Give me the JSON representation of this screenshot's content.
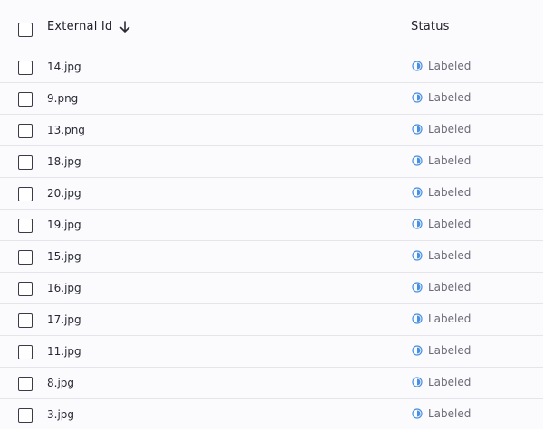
{
  "columns": {
    "external_id": "External Id",
    "status": "Status"
  },
  "sort_icon": "arrow-down-icon",
  "status_icon": "half-circle-icon",
  "status_color": "#4a90e2",
  "rows": [
    {
      "file": "14.jpg",
      "status": "Labeled"
    },
    {
      "file": "9.png",
      "status": "Labeled"
    },
    {
      "file": "13.png",
      "status": "Labeled"
    },
    {
      "file": "18.jpg",
      "status": "Labeled"
    },
    {
      "file": "20.jpg",
      "status": "Labeled"
    },
    {
      "file": "19.jpg",
      "status": "Labeled"
    },
    {
      "file": "15.jpg",
      "status": "Labeled"
    },
    {
      "file": "16.jpg",
      "status": "Labeled"
    },
    {
      "file": "17.jpg",
      "status": "Labeled"
    },
    {
      "file": "11.jpg",
      "status": "Labeled"
    },
    {
      "file": "8.jpg",
      "status": "Labeled"
    },
    {
      "file": "3.jpg",
      "status": "Labeled"
    }
  ]
}
